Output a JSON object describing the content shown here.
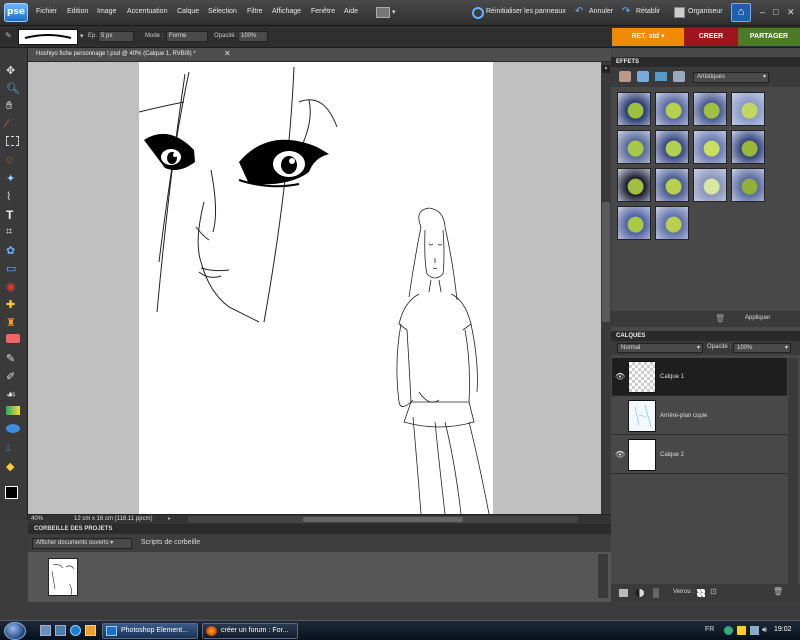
{
  "app": {
    "logo": "pse",
    "menu": [
      "Fichier",
      "Edition",
      "Image",
      "Accentuation",
      "Calque",
      "Sélection",
      "Filtre",
      "Affichage",
      "Fenêtre",
      "Aide"
    ],
    "right_actions": {
      "reset_panels": "Réinitialiser les panneaux",
      "undo": "Annuler",
      "redo": "Rétablir",
      "organizer": "Organiseur"
    },
    "accent_orange": "#f08a00",
    "accent_red": "#a0151c",
    "accent_green": "#4a7a2a"
  },
  "options": {
    "size_label": "Ep. :",
    "size_value": "5 px",
    "mode_label": "Mode :",
    "mode_value": "Forme",
    "opacity_label": "Opacité :",
    "opacity_value": "100%"
  },
  "tabs": {
    "edit": "RET. std",
    "create": "CREER",
    "share": "PARTAGER"
  },
  "document": {
    "tab_title": "Hoshiyo fiche personnage !.psd @ 40% (Calque 1, RVB/8) *",
    "zoom": "40%",
    "doc_info": "12 cm x 16 cm (118.11 ppcm)"
  },
  "project_bin": {
    "title": "CORBEILLE DES PROJETS",
    "show_dropdown": "Afficher documents ouverts",
    "scripts": "Scripts de corbeille"
  },
  "effects": {
    "title": "EFFETS",
    "category": "Artistiques",
    "apply": "Appliquer",
    "thumb_count": 18
  },
  "layers": {
    "title": "CALQUES",
    "blend_mode": "Normal",
    "opacity_label": "Opacité :",
    "opacity_value": "100%",
    "lock_label": "Verrou :",
    "items": [
      {
        "name": "Calque 1",
        "visible": true,
        "selected": true
      },
      {
        "name": "Arrière-plan copie",
        "visible": false,
        "selected": false
      },
      {
        "name": "Calque 2",
        "visible": true,
        "selected": false
      }
    ]
  },
  "taskbar": {
    "tasks": [
      "Photoshop Element...",
      "créer un forum : For..."
    ],
    "lang": "FR",
    "time": "19:02"
  }
}
